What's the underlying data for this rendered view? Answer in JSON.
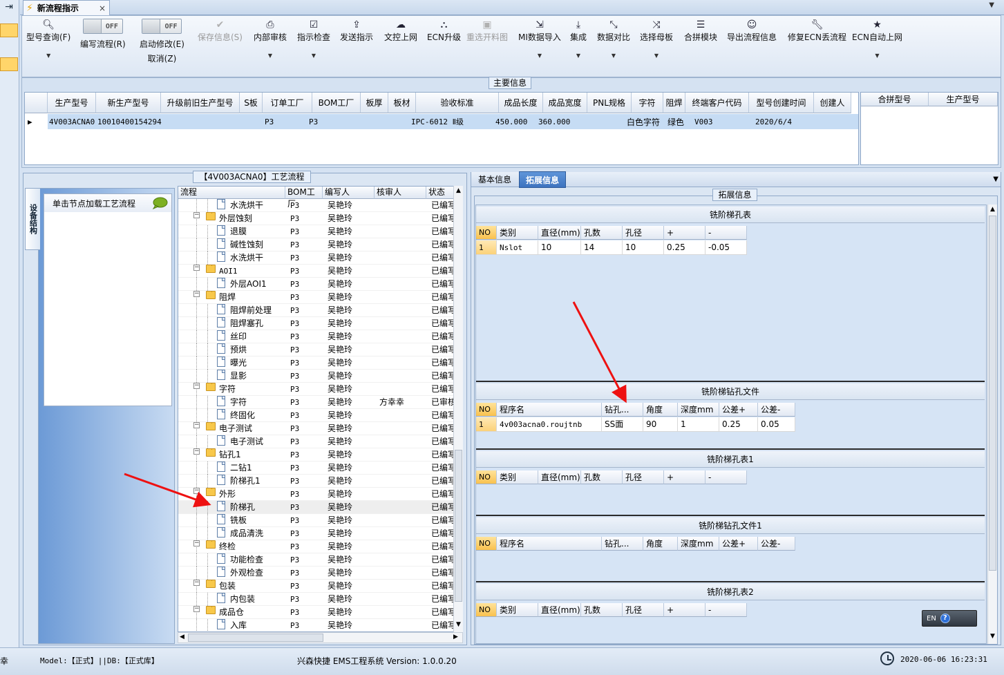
{
  "tab": {
    "title": "新流程指示",
    "close": "×"
  },
  "ribbon": {
    "query": "型号查询(F)",
    "edit_flow": "编写流程(R)",
    "edit_flow_toggle": "OFF",
    "auto_modify": "启动修改(E)",
    "auto_modify_toggle": "OFF",
    "cancel": "取消(Z)",
    "save": "保存信息(S)",
    "internal_review": "内部审核",
    "check": "指示检查",
    "send": "发送指示",
    "upload": "文控上网",
    "ecn_upgrade": "ECN升级",
    "reopen": "重选开料图",
    "mi_import": "MI数据导入",
    "integrate": "集成",
    "compare": "数据对比",
    "select_master": "选择母板",
    "combine": "合拼模块",
    "export": "导出流程信息",
    "fix_ecn": "修复ECN丢流程",
    "ecn_auto": "ECN自动上网"
  },
  "main_info": {
    "title": "主要信息",
    "headers": [
      "生产型号",
      "新生产型号",
      "升级前旧生产型号",
      "S板",
      "订单工厂",
      "BOM工厂",
      "板厚",
      "板材",
      "验收标准",
      "成品长度",
      "成品宽度",
      "PNL规格",
      "字符",
      "阻焊",
      "终端客户代码",
      "型号创建时间",
      "创建人"
    ],
    "row": {
      "model": "4V003ACNA0",
      "new_model": "10010400154294",
      "order_factory": "P3",
      "bom_factory": "P3",
      "standard": "IPC-6012 Ⅱ级",
      "length": "450.000",
      "width": "360.000",
      "char": "白色字符",
      "mask": "绿色",
      "customer": "V003",
      "created": "2020/6/4"
    },
    "side_headers": [
      "合拼型号",
      "生产型号"
    ]
  },
  "left": {
    "vtab": "设备结构",
    "side_item": "单击节点加载工艺流程",
    "tree_title": "【4V003ACNA0】工艺流程",
    "tree_headers": [
      "流程",
      "BOM工厂",
      "编写人",
      "核审人",
      "状态"
    ],
    "rows": [
      {
        "level": 2,
        "type": "doc",
        "name": "水洗烘干",
        "bom": "P3",
        "author": "吴艳玲",
        "reviewer": "",
        "status": "已编写"
      },
      {
        "level": 1,
        "type": "folder",
        "name": "外层蚀刻",
        "bom": "P3",
        "author": "吴艳玲",
        "reviewer": "",
        "status": "已编写"
      },
      {
        "level": 2,
        "type": "doc",
        "name": "退膜",
        "bom": "P3",
        "author": "吴艳玲",
        "reviewer": "",
        "status": "已编写"
      },
      {
        "level": 2,
        "type": "doc",
        "name": "碱性蚀刻",
        "bom": "P3",
        "author": "吴艳玲",
        "reviewer": "",
        "status": "已编写"
      },
      {
        "level": 2,
        "type": "doc",
        "name": "水洗烘干",
        "bom": "P3",
        "author": "吴艳玲",
        "reviewer": "",
        "status": "已编写"
      },
      {
        "level": 1,
        "type": "folder",
        "name": "AOI1",
        "bom": "P3",
        "author": "吴艳玲",
        "reviewer": "",
        "status": "已编写"
      },
      {
        "level": 2,
        "type": "doc",
        "name": "外层AOI1",
        "bom": "P3",
        "author": "吴艳玲",
        "reviewer": "",
        "status": "已编写"
      },
      {
        "level": 1,
        "type": "folder",
        "name": "阻焊",
        "bom": "P3",
        "author": "吴艳玲",
        "reviewer": "",
        "status": "已编写"
      },
      {
        "level": 2,
        "type": "doc",
        "name": "阻焊前处理",
        "bom": "P3",
        "author": "吴艳玲",
        "reviewer": "",
        "status": "已编写"
      },
      {
        "level": 2,
        "type": "doc",
        "name": "阻焊塞孔",
        "bom": "P3",
        "author": "吴艳玲",
        "reviewer": "",
        "status": "已编写"
      },
      {
        "level": 2,
        "type": "doc",
        "name": "丝印",
        "bom": "P3",
        "author": "吴艳玲",
        "reviewer": "",
        "status": "已编写"
      },
      {
        "level": 2,
        "type": "doc",
        "name": "预烘",
        "bom": "P3",
        "author": "吴艳玲",
        "reviewer": "",
        "status": "已编写"
      },
      {
        "level": 2,
        "type": "doc",
        "name": "曝光",
        "bom": "P3",
        "author": "吴艳玲",
        "reviewer": "",
        "status": "已编写"
      },
      {
        "level": 2,
        "type": "doc",
        "name": "显影",
        "bom": "P3",
        "author": "吴艳玲",
        "reviewer": "",
        "status": "已编写"
      },
      {
        "level": 1,
        "type": "folder",
        "name": "字符",
        "bom": "P3",
        "author": "吴艳玲",
        "reviewer": "",
        "status": "已编写"
      },
      {
        "level": 2,
        "type": "doc",
        "name": "字符",
        "bom": "P3",
        "author": "吴艳玲",
        "reviewer": "方幸幸",
        "status": "已审核"
      },
      {
        "level": 2,
        "type": "doc",
        "name": "终固化",
        "bom": "P3",
        "author": "吴艳玲",
        "reviewer": "",
        "status": "已编写"
      },
      {
        "level": 1,
        "type": "folder",
        "name": "电子测试",
        "bom": "P3",
        "author": "吴艳玲",
        "reviewer": "",
        "status": "已编写"
      },
      {
        "level": 2,
        "type": "doc",
        "name": "电子测试",
        "bom": "P3",
        "author": "吴艳玲",
        "reviewer": "",
        "status": "已编写"
      },
      {
        "level": 1,
        "type": "folder",
        "name": "钻孔1",
        "bom": "P3",
        "author": "吴艳玲",
        "reviewer": "",
        "status": "已编写"
      },
      {
        "level": 2,
        "type": "doc",
        "name": "二钻1",
        "bom": "P3",
        "author": "吴艳玲",
        "reviewer": "",
        "status": "已编写"
      },
      {
        "level": 2,
        "type": "doc",
        "name": "阶梯孔1",
        "bom": "P3",
        "author": "吴艳玲",
        "reviewer": "",
        "status": "已编写"
      },
      {
        "level": 1,
        "type": "folder",
        "name": "外形",
        "bom": "P3",
        "author": "吴艳玲",
        "reviewer": "",
        "status": "已编写"
      },
      {
        "level": 2,
        "type": "doc",
        "name": "阶梯孔",
        "bom": "P3",
        "author": "吴艳玲",
        "reviewer": "",
        "status": "已编写",
        "selected": true
      },
      {
        "level": 2,
        "type": "doc",
        "name": "铣板",
        "bom": "P3",
        "author": "吴艳玲",
        "reviewer": "",
        "status": "已编写"
      },
      {
        "level": 2,
        "type": "doc",
        "name": "成品清洗",
        "bom": "P3",
        "author": "吴艳玲",
        "reviewer": "",
        "status": "已编写"
      },
      {
        "level": 1,
        "type": "folder",
        "name": "终检",
        "bom": "P3",
        "author": "吴艳玲",
        "reviewer": "",
        "status": "已编写"
      },
      {
        "level": 2,
        "type": "doc",
        "name": "功能检查",
        "bom": "P3",
        "author": "吴艳玲",
        "reviewer": "",
        "status": "已编写"
      },
      {
        "level": 2,
        "type": "doc",
        "name": "外观检查",
        "bom": "P3",
        "author": "吴艳玲",
        "reviewer": "",
        "status": "已编写"
      },
      {
        "level": 1,
        "type": "folder",
        "name": "包装",
        "bom": "P3",
        "author": "吴艳玲",
        "reviewer": "",
        "status": "已编写"
      },
      {
        "level": 2,
        "type": "doc",
        "name": "内包装",
        "bom": "P3",
        "author": "吴艳玲",
        "reviewer": "",
        "status": "已编写"
      },
      {
        "level": 1,
        "type": "folder",
        "name": "成品仓",
        "bom": "P3",
        "author": "吴艳玲",
        "reviewer": "",
        "status": "已编写"
      },
      {
        "level": 2,
        "type": "doc",
        "name": "入库",
        "bom": "P3",
        "author": "吴艳玲",
        "reviewer": "",
        "status": "已编写"
      }
    ]
  },
  "right": {
    "tab_basic": "基本信息",
    "tab_ext": "拓展信息",
    "group_title": "拓展信息",
    "sections": [
      {
        "title": "铣阶梯孔表",
        "headers": [
          "NO",
          "类别",
          "直径(mm)",
          "孔数",
          "孔径",
          "+",
          "-"
        ],
        "rows": [
          [
            "1",
            "Nslot",
            "10",
            "14",
            "10",
            "0.25",
            "-0.05"
          ]
        ]
      },
      {
        "title": "铣阶梯钻孔文件",
        "headers": [
          "NO",
          "程序名",
          "钻孔...",
          "角度",
          "深度mm",
          "公差+",
          "公差-"
        ],
        "rows": [
          [
            "1",
            "4v003acna0.roujtnb",
            "SS面",
            "90",
            "1",
            "0.25",
            "0.05"
          ]
        ]
      },
      {
        "title": "铣阶梯孔表1",
        "headers": [
          "NO",
          "类别",
          "直径(mm)",
          "孔数",
          "孔径",
          "+",
          "-"
        ],
        "rows": []
      },
      {
        "title": "铣阶梯钻孔文件1",
        "headers": [
          "NO",
          "程序名",
          "钻孔...",
          "角度",
          "深度mm",
          "公差+",
          "公差-"
        ],
        "rows": []
      },
      {
        "title": "铣阶梯孔表2",
        "headers": [
          "NO",
          "类别",
          "直径(mm)",
          "孔数",
          "孔径",
          "+",
          "-"
        ],
        "rows": []
      }
    ],
    "ime": "EN",
    "ime_help": "?"
  },
  "status": {
    "left_char": "幸",
    "model": "Model:【正式】||DB:【正式库】",
    "system": "兴森快捷 EMS工程系统 Version: 1.0.0.20",
    "time": "2020-06-06 16:23:31"
  }
}
